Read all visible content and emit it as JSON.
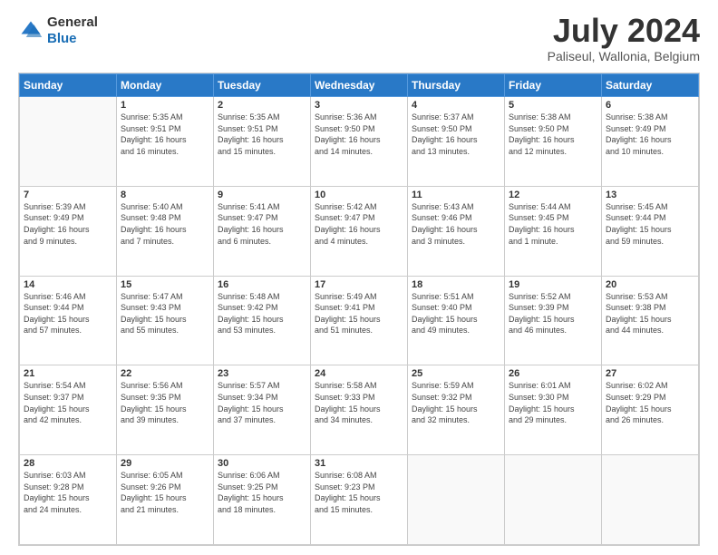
{
  "header": {
    "logo_line1": "General",
    "logo_line2": "Blue",
    "month_title": "July 2024",
    "location": "Paliseul, Wallonia, Belgium"
  },
  "days_of_week": [
    "Sunday",
    "Monday",
    "Tuesday",
    "Wednesday",
    "Thursday",
    "Friday",
    "Saturday"
  ],
  "weeks": [
    [
      {
        "day": "",
        "info": ""
      },
      {
        "day": "1",
        "info": "Sunrise: 5:35 AM\nSunset: 9:51 PM\nDaylight: 16 hours\nand 16 minutes."
      },
      {
        "day": "2",
        "info": "Sunrise: 5:35 AM\nSunset: 9:51 PM\nDaylight: 16 hours\nand 15 minutes."
      },
      {
        "day": "3",
        "info": "Sunrise: 5:36 AM\nSunset: 9:50 PM\nDaylight: 16 hours\nand 14 minutes."
      },
      {
        "day": "4",
        "info": "Sunrise: 5:37 AM\nSunset: 9:50 PM\nDaylight: 16 hours\nand 13 minutes."
      },
      {
        "day": "5",
        "info": "Sunrise: 5:38 AM\nSunset: 9:50 PM\nDaylight: 16 hours\nand 12 minutes."
      },
      {
        "day": "6",
        "info": "Sunrise: 5:38 AM\nSunset: 9:49 PM\nDaylight: 16 hours\nand 10 minutes."
      }
    ],
    [
      {
        "day": "7",
        "info": "Sunrise: 5:39 AM\nSunset: 9:49 PM\nDaylight: 16 hours\nand 9 minutes."
      },
      {
        "day": "8",
        "info": "Sunrise: 5:40 AM\nSunset: 9:48 PM\nDaylight: 16 hours\nand 7 minutes."
      },
      {
        "day": "9",
        "info": "Sunrise: 5:41 AM\nSunset: 9:47 PM\nDaylight: 16 hours\nand 6 minutes."
      },
      {
        "day": "10",
        "info": "Sunrise: 5:42 AM\nSunset: 9:47 PM\nDaylight: 16 hours\nand 4 minutes."
      },
      {
        "day": "11",
        "info": "Sunrise: 5:43 AM\nSunset: 9:46 PM\nDaylight: 16 hours\nand 3 minutes."
      },
      {
        "day": "12",
        "info": "Sunrise: 5:44 AM\nSunset: 9:45 PM\nDaylight: 16 hours\nand 1 minute."
      },
      {
        "day": "13",
        "info": "Sunrise: 5:45 AM\nSunset: 9:44 PM\nDaylight: 15 hours\nand 59 minutes."
      }
    ],
    [
      {
        "day": "14",
        "info": "Sunrise: 5:46 AM\nSunset: 9:44 PM\nDaylight: 15 hours\nand 57 minutes."
      },
      {
        "day": "15",
        "info": "Sunrise: 5:47 AM\nSunset: 9:43 PM\nDaylight: 15 hours\nand 55 minutes."
      },
      {
        "day": "16",
        "info": "Sunrise: 5:48 AM\nSunset: 9:42 PM\nDaylight: 15 hours\nand 53 minutes."
      },
      {
        "day": "17",
        "info": "Sunrise: 5:49 AM\nSunset: 9:41 PM\nDaylight: 15 hours\nand 51 minutes."
      },
      {
        "day": "18",
        "info": "Sunrise: 5:51 AM\nSunset: 9:40 PM\nDaylight: 15 hours\nand 49 minutes."
      },
      {
        "day": "19",
        "info": "Sunrise: 5:52 AM\nSunset: 9:39 PM\nDaylight: 15 hours\nand 46 minutes."
      },
      {
        "day": "20",
        "info": "Sunrise: 5:53 AM\nSunset: 9:38 PM\nDaylight: 15 hours\nand 44 minutes."
      }
    ],
    [
      {
        "day": "21",
        "info": "Sunrise: 5:54 AM\nSunset: 9:37 PM\nDaylight: 15 hours\nand 42 minutes."
      },
      {
        "day": "22",
        "info": "Sunrise: 5:56 AM\nSunset: 9:35 PM\nDaylight: 15 hours\nand 39 minutes."
      },
      {
        "day": "23",
        "info": "Sunrise: 5:57 AM\nSunset: 9:34 PM\nDaylight: 15 hours\nand 37 minutes."
      },
      {
        "day": "24",
        "info": "Sunrise: 5:58 AM\nSunset: 9:33 PM\nDaylight: 15 hours\nand 34 minutes."
      },
      {
        "day": "25",
        "info": "Sunrise: 5:59 AM\nSunset: 9:32 PM\nDaylight: 15 hours\nand 32 minutes."
      },
      {
        "day": "26",
        "info": "Sunrise: 6:01 AM\nSunset: 9:30 PM\nDaylight: 15 hours\nand 29 minutes."
      },
      {
        "day": "27",
        "info": "Sunrise: 6:02 AM\nSunset: 9:29 PM\nDaylight: 15 hours\nand 26 minutes."
      }
    ],
    [
      {
        "day": "28",
        "info": "Sunrise: 6:03 AM\nSunset: 9:28 PM\nDaylight: 15 hours\nand 24 minutes."
      },
      {
        "day": "29",
        "info": "Sunrise: 6:05 AM\nSunset: 9:26 PM\nDaylight: 15 hours\nand 21 minutes."
      },
      {
        "day": "30",
        "info": "Sunrise: 6:06 AM\nSunset: 9:25 PM\nDaylight: 15 hours\nand 18 minutes."
      },
      {
        "day": "31",
        "info": "Sunrise: 6:08 AM\nSunset: 9:23 PM\nDaylight: 15 hours\nand 15 minutes."
      },
      {
        "day": "",
        "info": ""
      },
      {
        "day": "",
        "info": ""
      },
      {
        "day": "",
        "info": ""
      }
    ]
  ]
}
